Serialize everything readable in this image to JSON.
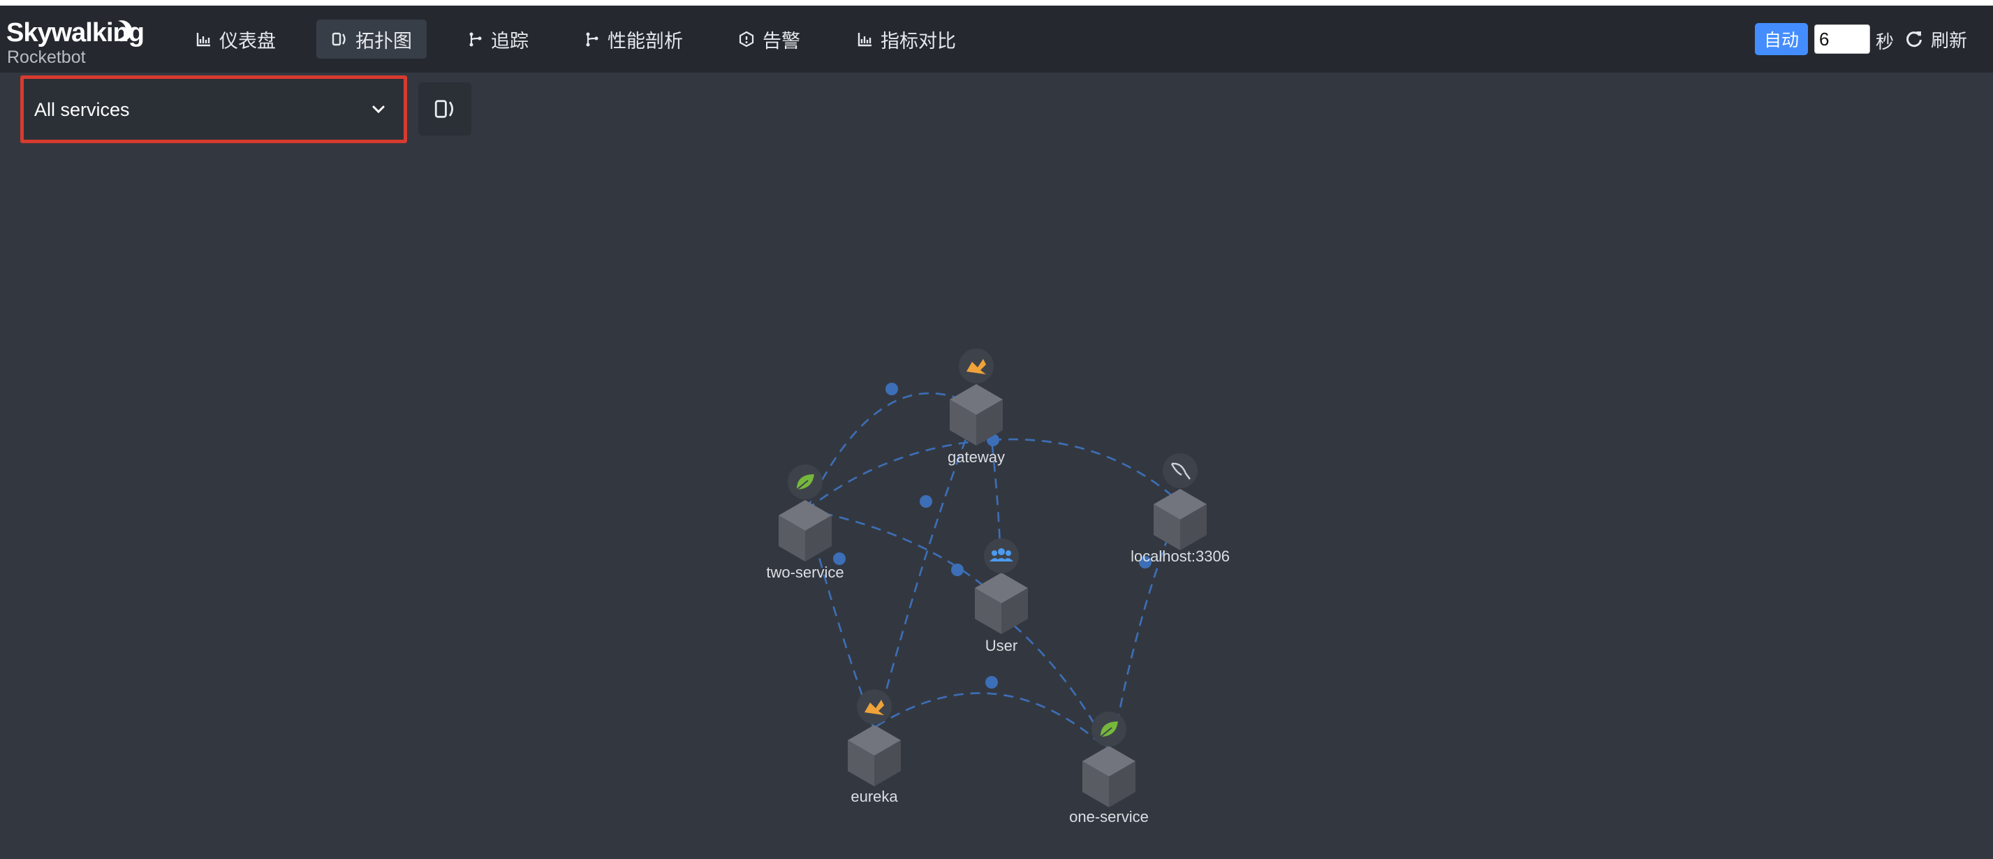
{
  "brand": {
    "name": "Skywalking",
    "subtitle": "Rocketbot"
  },
  "nav": [
    {
      "label": "仪表盘",
      "icon": "chart-icon"
    },
    {
      "label": "拓扑图",
      "icon": "topology-icon",
      "active": true
    },
    {
      "label": "追踪",
      "icon": "trace-icon"
    },
    {
      "label": "性能剖析",
      "icon": "profile-icon"
    },
    {
      "label": "告警",
      "icon": "alarm-icon"
    },
    {
      "label": "指标对比",
      "icon": "chart-icon"
    }
  ],
  "toolbar": {
    "auto_label": "自动",
    "interval_value": "6",
    "seconds_label": "秒",
    "refresh_label": "刷新"
  },
  "service_select": {
    "selected": "All services"
  },
  "topology": {
    "nodes": [
      {
        "id": "gateway",
        "label": "gateway",
        "icon": "tomcat-icon"
      },
      {
        "id": "two-service",
        "label": "two-service",
        "icon": "spring-icon"
      },
      {
        "id": "localhost",
        "label": "localhost:3306",
        "icon": "mysql-icon"
      },
      {
        "id": "user",
        "label": "User",
        "icon": "users-icon"
      },
      {
        "id": "eureka",
        "label": "eureka",
        "icon": "tomcat-icon"
      },
      {
        "id": "one-service",
        "label": "one-service",
        "icon": "spring-icon"
      }
    ]
  },
  "colors": {
    "accent": "#448dfe",
    "link": "#3d6fb8",
    "highlight": "#d63b2f",
    "background": "#333840",
    "navbar": "#25292f"
  }
}
